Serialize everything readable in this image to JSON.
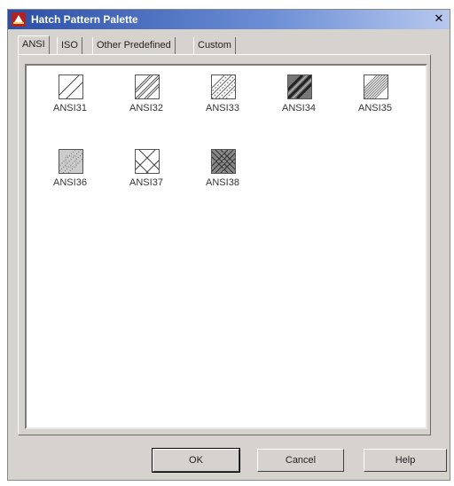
{
  "window": {
    "title": "Hatch Pattern Palette",
    "close_glyph": "✕"
  },
  "tabs": [
    {
      "label": "ANSI",
      "active": true
    },
    {
      "label": "ISO",
      "active": false
    },
    {
      "label": "Other Predefined",
      "active": false
    },
    {
      "label": "Custom",
      "active": false
    }
  ],
  "patterns": [
    {
      "label": "ANSI31",
      "icon": "diagonal-hatch-icon"
    },
    {
      "label": "ANSI32",
      "icon": "double-diagonal-hatch-icon"
    },
    {
      "label": "ANSI33",
      "icon": "dashed-diagonal-hatch-icon"
    },
    {
      "label": "ANSI34",
      "icon": "bold-diagonal-hatch-icon"
    },
    {
      "label": "ANSI35",
      "icon": "fine-diagonal-hatch-icon"
    },
    {
      "label": "ANSI36",
      "icon": "dotted-hatch-icon"
    },
    {
      "label": "ANSI37",
      "icon": "crosshatch-icon"
    },
    {
      "label": "ANSI38",
      "icon": "dense-crosshatch-icon"
    }
  ],
  "buttons": {
    "ok": "OK",
    "cancel": "Cancel",
    "help": "Help"
  },
  "colors": {
    "title_bar": "#2b4fa8",
    "dialog_face": "#d6d3ce",
    "palette_bg": "#ffffff"
  }
}
